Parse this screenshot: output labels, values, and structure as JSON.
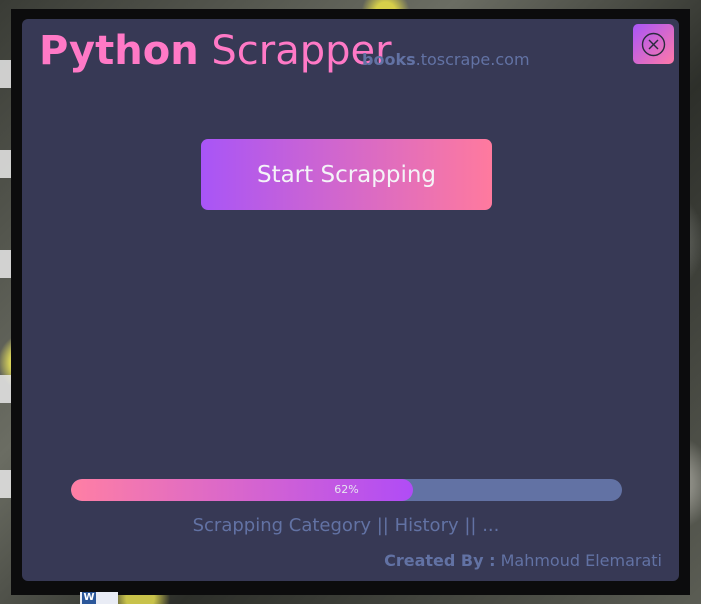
{
  "app": {
    "title_bold": "Python",
    "title_regular": "Scrapper",
    "site_bold": "books",
    "site_rest": ".toscrape.com",
    "accent": "#ff79c6",
    "background": "#373955"
  },
  "close_button": {
    "icon": "close-circle-icon"
  },
  "start_button": {
    "label": "Start Scrapping"
  },
  "progress": {
    "value": 0.62,
    "label": "62%"
  },
  "nav": {
    "category": "Scrapping Category",
    "sep1": " || ",
    "history": "History",
    "sep2": " || ",
    "more": "..."
  },
  "footer": {
    "created_by_label": "Created By :",
    "author": "Mahmoud Elemarati"
  },
  "taskbar": {
    "word_icon_letter": "W"
  }
}
